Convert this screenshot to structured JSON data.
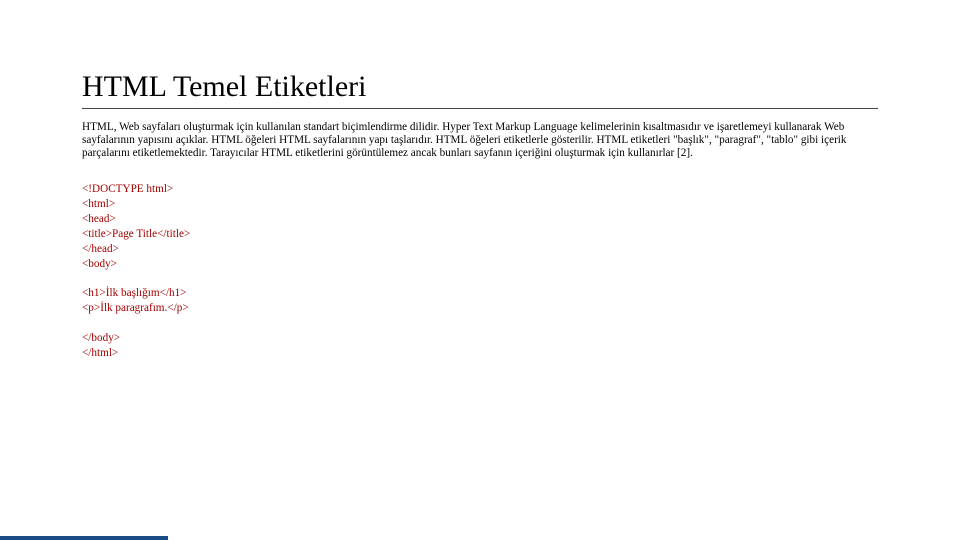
{
  "title": "HTML Temel Etiketleri",
  "paragraph": "HTML, Web sayfaları oluşturmak için kullanılan standart biçimlendirme dilidir. Hyper Text Markup Language kelimelerinin kısaltmasıdır ve işaretlemeyi kullanarak Web sayfalarının yapısını açıklar. HTML öğeleri HTML sayfalarının yapı taşlarıdır. HTML öğeleri etiketlerle gösterilir. HTML etiketleri \"başlık\", \"paragraf\", \"tablo\" gibi içerik parçalarını etiketlemektedir. Tarayıcılar HTML etiketlerini görüntülemez ancak bunları sayfanın içeriğini oluşturmak için kullanırlar [2].",
  "code": {
    "l1": "<!DOCTYPE html>",
    "l2": "<html>",
    "l3": "<head>",
    "l4": "<title>Page Title</title>",
    "l5": "</head>",
    "l6": "<body>",
    "l7": "<h1>İlk başlığım</h1>",
    "l8": "<p>İlk paragrafım.</p>",
    "l9": "</body>",
    "l10": "</html>"
  }
}
